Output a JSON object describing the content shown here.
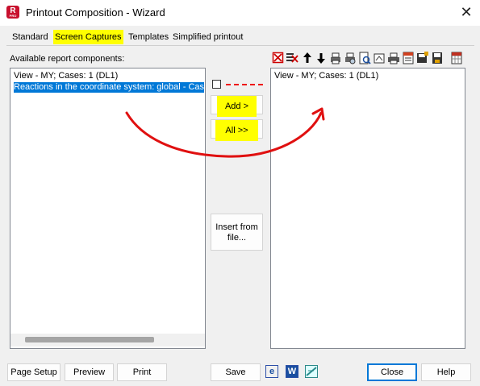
{
  "window": {
    "title": "Printout Composition - Wizard",
    "app_icon_letter": "R",
    "app_icon_sub": "PRO"
  },
  "tabs": [
    {
      "label": "Standard"
    },
    {
      "label": "Screen Captures",
      "active": true
    },
    {
      "label": "Templates"
    },
    {
      "label": "Simplified printout"
    }
  ],
  "left_panel": {
    "title": "Available report components:",
    "items": [
      {
        "label": "View - MY; Cases: 1 (DL1)"
      },
      {
        "label": "Reactions in the coordinate system: global - Case",
        "selected": true
      }
    ]
  },
  "middle": {
    "add_label": "Add >",
    "all_label": "All >>",
    "insert_label_1": "Insert from",
    "insert_label_2": "file..."
  },
  "right_panel": {
    "items": [
      {
        "label": "View - MY; Cases: 1 (DL1)"
      }
    ]
  },
  "toolbar_icons": [
    "delete-icon",
    "delete-all-icon",
    "move-up-icon",
    "move-down-icon",
    "print-setup-icon",
    "print-preview-icon",
    "page-preview-icon",
    "page-setup-icon",
    "print-icon",
    "template-icon",
    "save-template-icon",
    "save-icon",
    "grid-icon"
  ],
  "footer": {
    "page_setup": "Page Setup",
    "preview": "Preview",
    "print": "Print",
    "save": "Save",
    "close": "Close",
    "help": "Help"
  },
  "colors": {
    "highlight": "#ffff00",
    "selection": "#0078d7",
    "annotation_arrow": "#e01010",
    "app_icon": "#c8102e"
  }
}
